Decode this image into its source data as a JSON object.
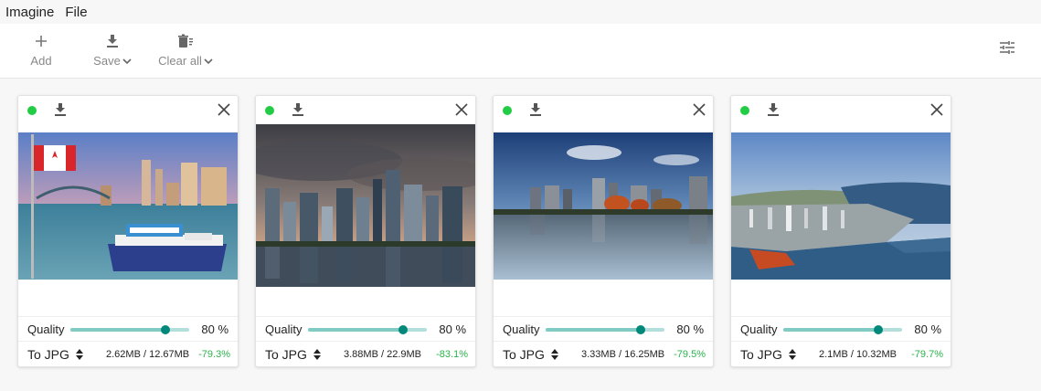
{
  "menu": {
    "app": "Imagine",
    "file": "File"
  },
  "toolbar": {
    "add_label": "Add",
    "save_label": "Save",
    "clear_label": "Clear all",
    "icons": [
      "plus-icon",
      "download-icon",
      "clear-all-icon",
      "sliders-icon"
    ]
  },
  "colors": {
    "accent": "#00897b",
    "track": "#b2dfdb",
    "status_ok": "#22cc44",
    "saving": "#2ab44a"
  },
  "cards": [
    {
      "quality_label": "Quality",
      "quality_value": "80",
      "quality_unit": "%",
      "quality_level": 0.8,
      "format": "To JPG",
      "sizes": "2.62MB / 12.67MB",
      "saving": "-79.3%",
      "image": "Vancouver harbour with Canadian flag and boat"
    },
    {
      "quality_label": "Quality",
      "quality_value": "80",
      "quality_unit": "%",
      "quality_level": 0.8,
      "format": "To JPG",
      "sizes": "3.88MB / 22.9MB",
      "saving": "-83.1%",
      "image": "City skyline with dramatic clouds and reflection"
    },
    {
      "quality_label": "Quality",
      "quality_value": "80",
      "quality_unit": "%",
      "quality_level": 0.8,
      "format": "To JPG",
      "sizes": "3.33MB / 16.25MB",
      "saving": "-79.5%",
      "image": "Skyline across calm water with autumn trees"
    },
    {
      "quality_label": "Quality",
      "quality_value": "80",
      "quality_unit": "%",
      "quality_level": 0.8,
      "format": "To JPG",
      "sizes": "2.1MB / 10.32MB",
      "saving": "-79.7%",
      "image": "Aerial view of city, port and bay"
    }
  ]
}
